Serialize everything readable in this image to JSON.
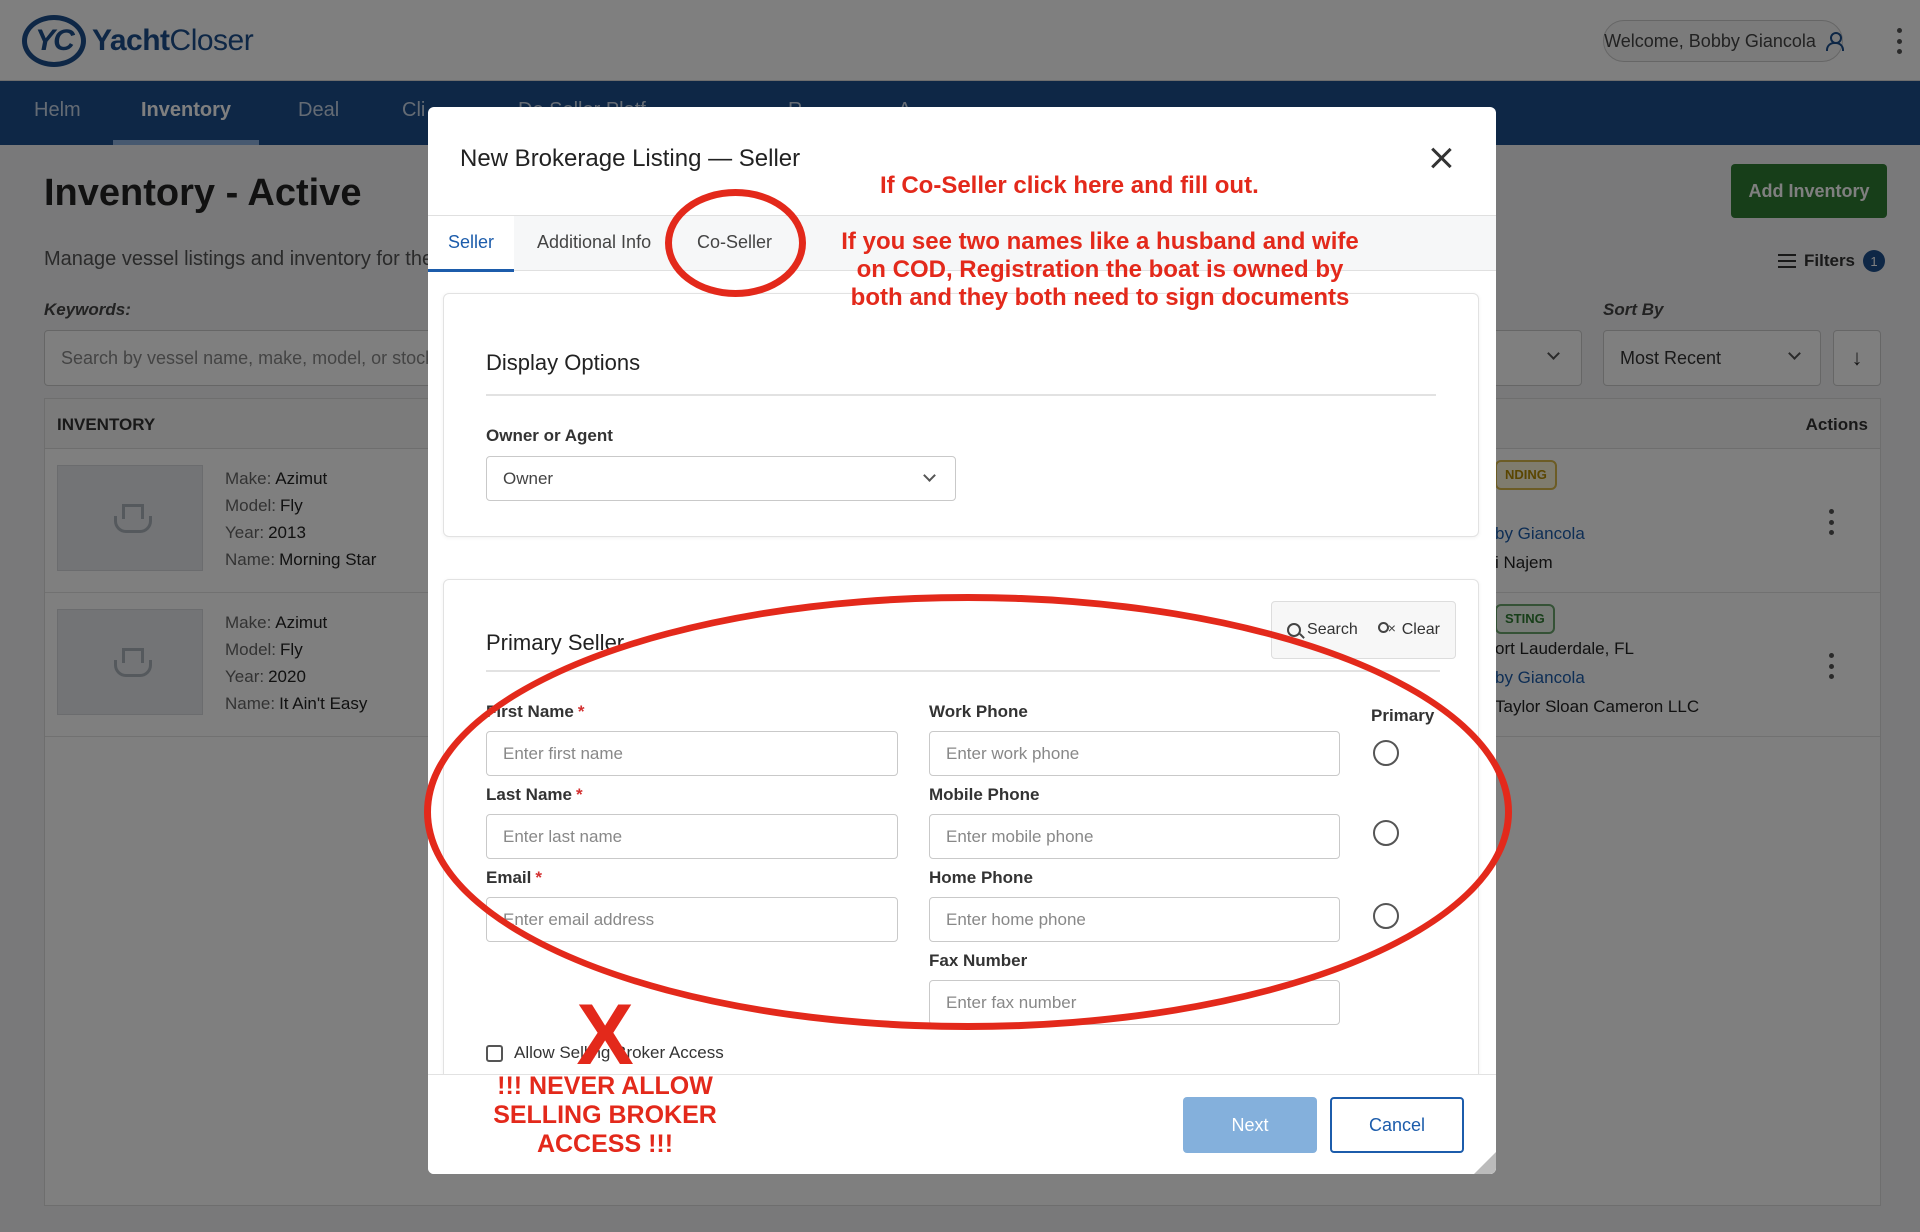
{
  "app": {
    "brand_mark": "YC",
    "brand_name_bold": "Yacht",
    "brand_name_light": "Closer",
    "welcome": "Welcome, Bobby Giancola"
  },
  "nav": {
    "items": [
      "Helm",
      "Inventory",
      "Deal",
      "Cli",
      "De Seller Platf",
      "R",
      "A"
    ]
  },
  "page": {
    "title": "Inventory - Active",
    "subtitle": "Manage vessel listings and inventory for the",
    "add_button": "Add Inventory",
    "filters_label": "Filters",
    "filters_count": "1",
    "keywords_label": "Keywords:",
    "keywords_placeholder": "Search by vessel name, make, model, or stock n",
    "sort_label": "Sort By",
    "sort_value": "Most Recent",
    "sort_dir_glyph": "↓"
  },
  "table": {
    "col_inventory": "INVENTORY",
    "col_actions": "Actions",
    "spec_labels": {
      "make": "Make:",
      "model": "Model:",
      "year": "Year:",
      "name": "Name:"
    },
    "rows": [
      {
        "make": "Azimut",
        "model": "Fly",
        "year": "2013",
        "name": "Morning Star",
        "status": "NDING",
        "location": "",
        "broker": "by Giancola",
        "contact": "i Najem"
      },
      {
        "make": "Azimut",
        "model": "Fly",
        "year": "2020",
        "name": "It Ain't Easy",
        "status": "STING",
        "location": "ort Lauderdale, FL",
        "broker": "by Giancola",
        "contact": "Taylor Sloan Cameron LLC"
      }
    ]
  },
  "modal": {
    "title": "New Brokerage Listing — Seller",
    "tabs": [
      "Seller",
      "Additional Info",
      "Co-Seller"
    ],
    "display_options": {
      "title": "Display Options",
      "owner_label": "Owner or Agent",
      "owner_value": "Owner"
    },
    "primary_seller": {
      "title": "Primary Seller",
      "search_label": "Search",
      "clear_label": "Clear",
      "first_name_label": "First Name",
      "first_name_placeholder": "Enter first name",
      "last_name_label": "Last Name",
      "last_name_placeholder": "Enter last name",
      "email_label": "Email",
      "email_placeholder": "Enter email address",
      "work_phone_label": "Work Phone",
      "work_phone_placeholder": "Enter work phone",
      "mobile_phone_label": "Mobile Phone",
      "mobile_phone_placeholder": "Enter mobile phone",
      "home_phone_label": "Home Phone",
      "home_phone_placeholder": "Enter home phone",
      "fax_label": "Fax Number",
      "fax_placeholder": "Enter fax number",
      "primary_label": "Primary",
      "required_mark": "*",
      "allow_access_label": "Allow Selling Broker Access"
    },
    "footer": {
      "next_label": "Next",
      "cancel_label": "Cancel"
    }
  },
  "annotations": {
    "coseller_hint": "If Co-Seller click here and fill out.",
    "two_names_line1": "If you see two names like a husband and wife",
    "two_names_line2": "on COD, Registration the boat is owned by",
    "two_names_line3": "both and they both need to sign documents",
    "x_mark": "X",
    "never_line1": "!!! NEVER ALLOW",
    "never_line2": "SELLING BROKER",
    "never_line3": "ACCESS !!!"
  },
  "colors": {
    "brand_blue": "#1c4f8c",
    "add_green": "#2e7d32",
    "annotation_red": "#e3291b",
    "next_disabled": "#84b0dc"
  }
}
